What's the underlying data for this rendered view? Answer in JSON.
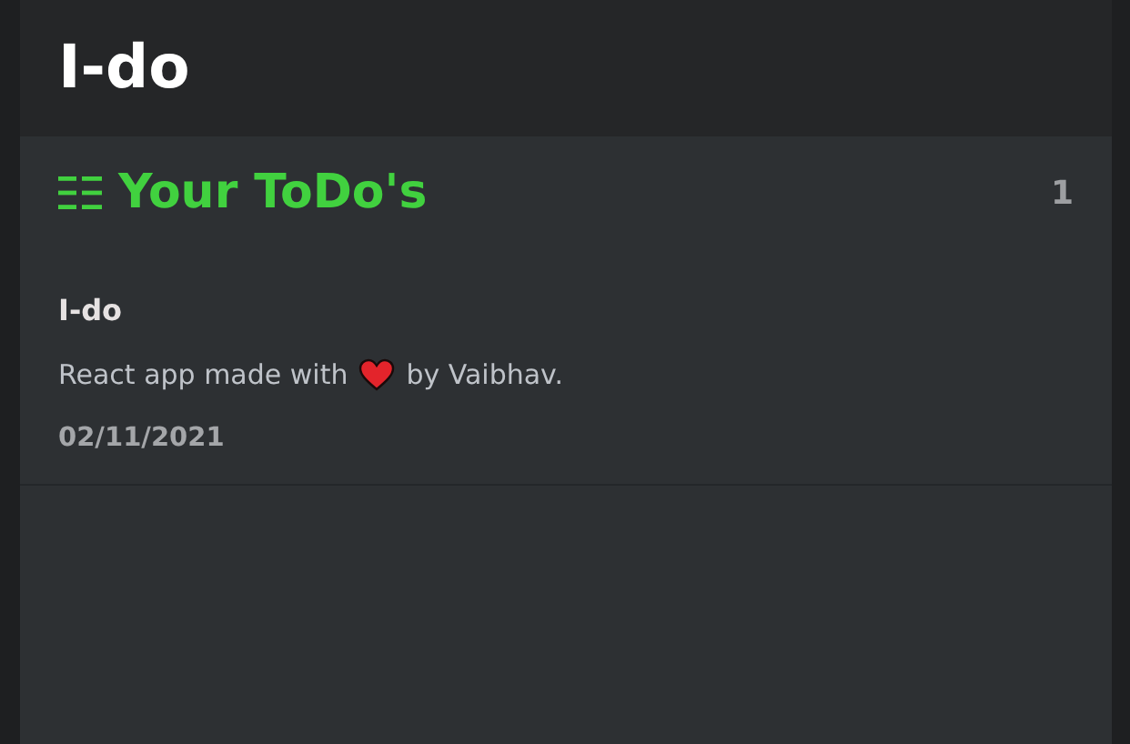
{
  "app_title": "I-do",
  "section": {
    "title": "Your ToDo's",
    "count": "1"
  },
  "todos": [
    {
      "title": "I-do",
      "text_before_icon": "React app made with",
      "text_after_icon": "by Vaibhav.",
      "date": "02/11/2021"
    }
  ]
}
